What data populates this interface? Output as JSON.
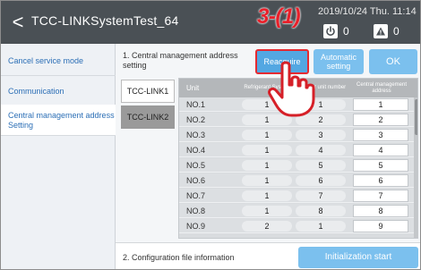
{
  "header": {
    "back_glyph": "<",
    "title": "TCC-LINKSystemTest_64",
    "datetime": "2019/10/24 Thu. 11:14",
    "power_count": "0",
    "warning_count": "0"
  },
  "annotation": {
    "step": "3-(1)"
  },
  "sidebar": {
    "items": [
      {
        "label": "Cancel service mode"
      },
      {
        "label": "Communication"
      },
      {
        "label": "Central management address Setting"
      }
    ]
  },
  "main": {
    "section1_label": "1. Central management address setting",
    "buttons": {
      "reacquire": "Reacquire",
      "automatic": "Automatic setting",
      "ok": "OK"
    },
    "tabs": [
      "TCC-LINK1",
      "TCC-LINK2"
    ],
    "table": {
      "columns": [
        "Unit",
        "Refrigerant System",
        "Indoor unit number",
        "Central management address"
      ],
      "rows": [
        {
          "unit": "NO.1",
          "system": "1",
          "indoor": "1",
          "address": "1"
        },
        {
          "unit": "NO.2",
          "system": "1",
          "indoor": "2",
          "address": "2"
        },
        {
          "unit": "NO.3",
          "system": "1",
          "indoor": "3",
          "address": "3"
        },
        {
          "unit": "NO.4",
          "system": "1",
          "indoor": "4",
          "address": "4"
        },
        {
          "unit": "NO.5",
          "system": "1",
          "indoor": "5",
          "address": "5"
        },
        {
          "unit": "NO.6",
          "system": "1",
          "indoor": "6",
          "address": "6"
        },
        {
          "unit": "NO.7",
          "system": "1",
          "indoor": "7",
          "address": "7"
        },
        {
          "unit": "NO.8",
          "system": "1",
          "indoor": "8",
          "address": "8"
        },
        {
          "unit": "NO.9",
          "system": "2",
          "indoor": "1",
          "address": "9"
        }
      ]
    },
    "section2_label": "2. Configuration file information",
    "init_button": "Initialization start"
  },
  "colors": {
    "header": "#4a5055",
    "accent_blue": "#53a7e2",
    "light_blue": "#7bc0ee",
    "annotation_red": "#e8202a"
  },
  "icons": [
    "back-arrow-icon",
    "power-icon",
    "warning-icon",
    "pointing-hand-icon"
  ]
}
